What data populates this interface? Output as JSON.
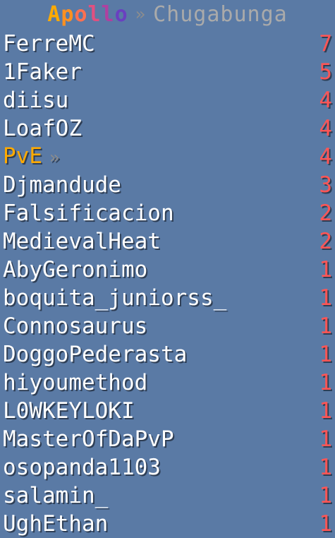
{
  "header": {
    "logo_letters": [
      {
        "ch": "A",
        "color": "#ffaa00"
      },
      {
        "ch": "p",
        "color": "#ff9020"
      },
      {
        "ch": "o",
        "color": "#ff7050"
      },
      {
        "ch": "l",
        "color": "#e05080"
      },
      {
        "ch": "l",
        "color": "#b040a0"
      },
      {
        "ch": "o",
        "color": "#6a40c0"
      }
    ],
    "separator": "»",
    "server_name": "Chugabunga"
  },
  "rows": [
    {
      "name": "FerreMC",
      "score": "7",
      "highlight": false
    },
    {
      "name": "1Faker",
      "score": "5",
      "highlight": false
    },
    {
      "name": "diisu",
      "score": "4",
      "highlight": false
    },
    {
      "name": "LoafOZ",
      "score": "4",
      "highlight": false
    },
    {
      "name": "PvE",
      "score": "4",
      "highlight": true,
      "suffix": "»"
    },
    {
      "name": "Djmandude",
      "score": "3",
      "highlight": false
    },
    {
      "name": "Falsificacion",
      "score": "2",
      "highlight": false
    },
    {
      "name": "MedievalHeat",
      "score": "2",
      "highlight": false
    },
    {
      "name": "AbyGeronimo",
      "score": "1",
      "highlight": false
    },
    {
      "name": "boquita_juniorss_",
      "score": "1",
      "highlight": false
    },
    {
      "name": "Connosaurus",
      "score": "1",
      "highlight": false
    },
    {
      "name": "DoggoPederasta",
      "score": "1",
      "highlight": false
    },
    {
      "name": "hiyoumethod",
      "score": "1",
      "highlight": false
    },
    {
      "name": "L0WKEYLOKI",
      "score": "1",
      "highlight": false
    },
    {
      "name": "MasterOfDaPvP",
      "score": "1",
      "highlight": false
    },
    {
      "name": "osopanda1103",
      "score": "1",
      "highlight": false
    },
    {
      "name": "salamin_",
      "score": "1",
      "highlight": false
    },
    {
      "name": "UghEthan",
      "score": "1",
      "highlight": false
    }
  ]
}
